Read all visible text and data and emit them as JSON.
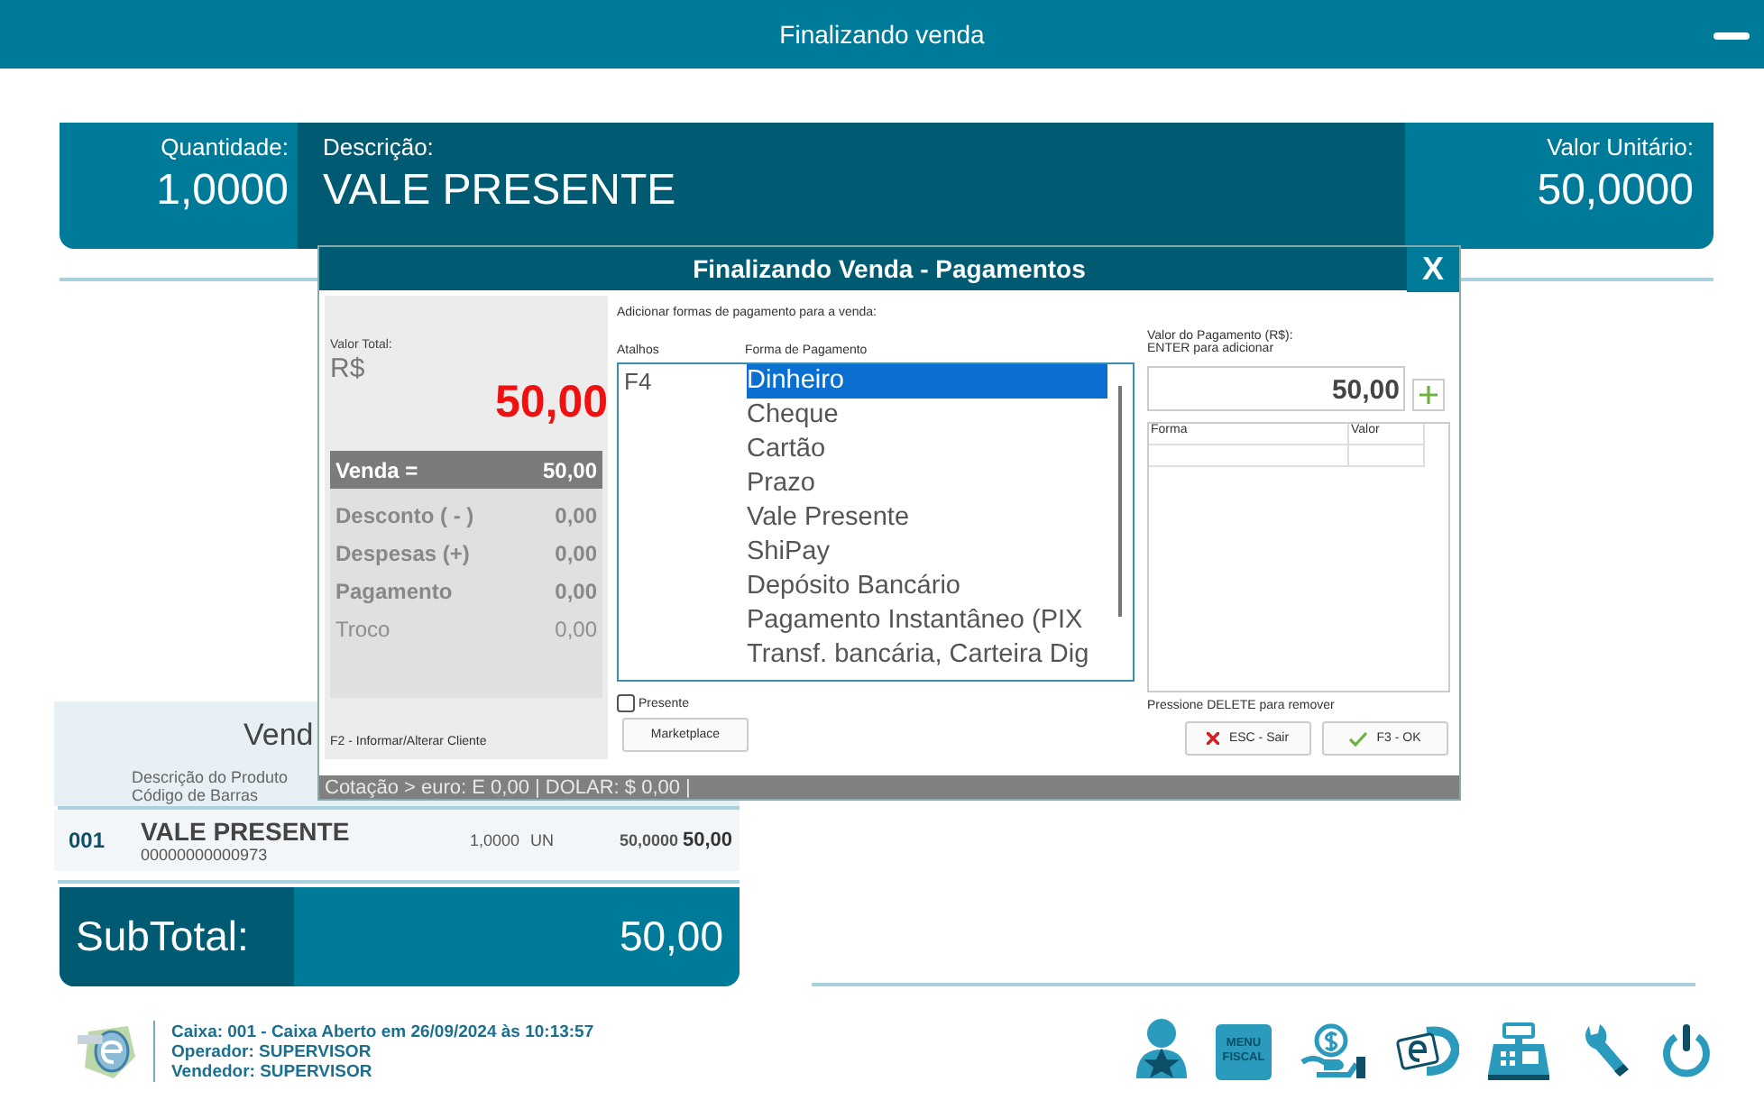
{
  "window": {
    "title": "Finalizando venda"
  },
  "item_header": {
    "quantity_label": "Quantidade:",
    "quantity": "1,0000",
    "description_label": "Descrição:",
    "description": "VALE PRESENTE",
    "unit_price_label": "Valor Unitário:",
    "unit_price": "50,0000"
  },
  "sale_panel": {
    "title": "Vend",
    "columns": [
      "Descrição do Produto",
      "Código de Barras"
    ],
    "items": [
      {
        "number": "001",
        "name": "VALE PRESENTE",
        "barcode": "00000000000973",
        "quantity": "1,0000",
        "unit": "UN",
        "unit_price": "50,0000",
        "total": "50,00"
      }
    ],
    "subtotal_label": "SubTotal:",
    "subtotal": "50,00"
  },
  "footer": {
    "lines": [
      "Caixa: 001 - Caixa Aberto em 26/09/2024 às 10:13:57",
      "Operador: SUPERVISOR",
      "Vendedor: SUPERVISOR"
    ],
    "toolbar": [
      {
        "kind": "customer"
      },
      {
        "kind": "menu",
        "label": "MENU FISCAL"
      },
      {
        "kind": "payment"
      },
      {
        "kind": "ecommerce"
      },
      {
        "kind": "register"
      },
      {
        "kind": "tools"
      },
      {
        "kind": "power"
      }
    ]
  },
  "dialog": {
    "title": "Finalizando Venda - Pagamentos",
    "close": "X",
    "total_label": "Valor Total:",
    "currency": "R$",
    "total": "50,00",
    "summary": [
      {
        "kind": "total",
        "label": "Venda =",
        "value": "50,00",
        "disabled": false
      },
      {
        "kind": "line",
        "label": "Desconto ( - )",
        "value": "0,00",
        "disabled": false
      },
      {
        "kind": "line",
        "label": "Despesas (+)",
        "value": "0,00",
        "disabled": false
      },
      {
        "kind": "line",
        "label": "Pagamento",
        "value": "0,00",
        "disabled": false
      },
      {
        "kind": "line",
        "label": "Troco",
        "value": "0,00",
        "disabled": true
      }
    ],
    "client_hint": "F2 - Informar/Alterar Cliente",
    "instructions": "Adicionar formas de pagamento para a venda:",
    "columns": [
      "Atalhos",
      "Forma de Pagamento"
    ],
    "shortcut": "F4",
    "methods": [
      {
        "label": "Dinheiro",
        "selected": true
      },
      {
        "label": "Cheque",
        "selected": false
      },
      {
        "label": "Cartão",
        "selected": false
      },
      {
        "label": "Prazo",
        "selected": false
      },
      {
        "label": "Vale Presente",
        "selected": false
      },
      {
        "label": "ShiPay",
        "selected": false
      },
      {
        "label": "Depósito Bancário",
        "selected": false
      },
      {
        "label": "Pagamento Instantâneo (PIX",
        "selected": false
      },
      {
        "label": "Transf. bancária, Carteira Dig",
        "selected": false
      }
    ],
    "gift_checkbox": {
      "label": "Presente",
      "checked": false
    },
    "marketplace_button": "Marketplace",
    "amount_label": "Valor do Pagamento (R$):",
    "amount_hint": "ENTER para adicionar",
    "amount": "50,00",
    "payments_table": {
      "columns": [
        "Forma",
        "Valor"
      ]
    },
    "remove_hint": "Pressione DELETE para remover",
    "buttons": [
      {
        "kind": "cancel",
        "label": "ESC - Sair"
      },
      {
        "kind": "ok",
        "label": "F3 - OK"
      }
    ],
    "status_bar": "Cotação > euro: E 0,00 | DOLAR: $ 0,00 |"
  }
}
